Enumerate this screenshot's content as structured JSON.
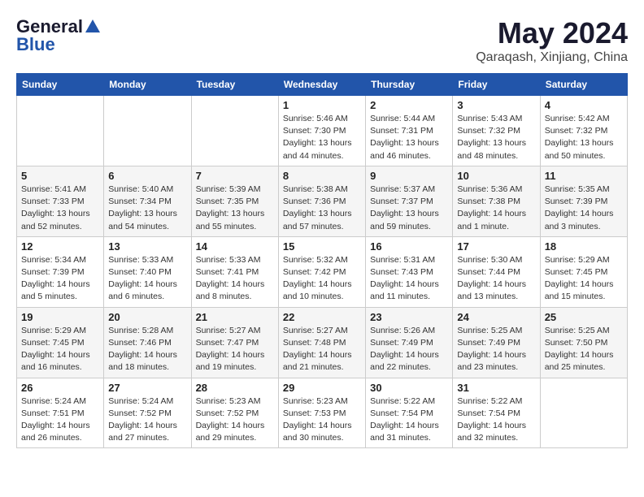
{
  "logo": {
    "general": "General",
    "blue": "Blue"
  },
  "title": "May 2024",
  "location": "Qaraqash, Xinjiang, China",
  "headers": [
    "Sunday",
    "Monday",
    "Tuesday",
    "Wednesday",
    "Thursday",
    "Friday",
    "Saturday"
  ],
  "weeks": [
    [
      {
        "day": "",
        "info": ""
      },
      {
        "day": "",
        "info": ""
      },
      {
        "day": "",
        "info": ""
      },
      {
        "day": "1",
        "info": "Sunrise: 5:46 AM\nSunset: 7:30 PM\nDaylight: 13 hours\nand 44 minutes."
      },
      {
        "day": "2",
        "info": "Sunrise: 5:44 AM\nSunset: 7:31 PM\nDaylight: 13 hours\nand 46 minutes."
      },
      {
        "day": "3",
        "info": "Sunrise: 5:43 AM\nSunset: 7:32 PM\nDaylight: 13 hours\nand 48 minutes."
      },
      {
        "day": "4",
        "info": "Sunrise: 5:42 AM\nSunset: 7:32 PM\nDaylight: 13 hours\nand 50 minutes."
      }
    ],
    [
      {
        "day": "5",
        "info": "Sunrise: 5:41 AM\nSunset: 7:33 PM\nDaylight: 13 hours\nand 52 minutes."
      },
      {
        "day": "6",
        "info": "Sunrise: 5:40 AM\nSunset: 7:34 PM\nDaylight: 13 hours\nand 54 minutes."
      },
      {
        "day": "7",
        "info": "Sunrise: 5:39 AM\nSunset: 7:35 PM\nDaylight: 13 hours\nand 55 minutes."
      },
      {
        "day": "8",
        "info": "Sunrise: 5:38 AM\nSunset: 7:36 PM\nDaylight: 13 hours\nand 57 minutes."
      },
      {
        "day": "9",
        "info": "Sunrise: 5:37 AM\nSunset: 7:37 PM\nDaylight: 13 hours\nand 59 minutes."
      },
      {
        "day": "10",
        "info": "Sunrise: 5:36 AM\nSunset: 7:38 PM\nDaylight: 14 hours\nand 1 minute."
      },
      {
        "day": "11",
        "info": "Sunrise: 5:35 AM\nSunset: 7:39 PM\nDaylight: 14 hours\nand 3 minutes."
      }
    ],
    [
      {
        "day": "12",
        "info": "Sunrise: 5:34 AM\nSunset: 7:39 PM\nDaylight: 14 hours\nand 5 minutes."
      },
      {
        "day": "13",
        "info": "Sunrise: 5:33 AM\nSunset: 7:40 PM\nDaylight: 14 hours\nand 6 minutes."
      },
      {
        "day": "14",
        "info": "Sunrise: 5:33 AM\nSunset: 7:41 PM\nDaylight: 14 hours\nand 8 minutes."
      },
      {
        "day": "15",
        "info": "Sunrise: 5:32 AM\nSunset: 7:42 PM\nDaylight: 14 hours\nand 10 minutes."
      },
      {
        "day": "16",
        "info": "Sunrise: 5:31 AM\nSunset: 7:43 PM\nDaylight: 14 hours\nand 11 minutes."
      },
      {
        "day": "17",
        "info": "Sunrise: 5:30 AM\nSunset: 7:44 PM\nDaylight: 14 hours\nand 13 minutes."
      },
      {
        "day": "18",
        "info": "Sunrise: 5:29 AM\nSunset: 7:45 PM\nDaylight: 14 hours\nand 15 minutes."
      }
    ],
    [
      {
        "day": "19",
        "info": "Sunrise: 5:29 AM\nSunset: 7:45 PM\nDaylight: 14 hours\nand 16 minutes."
      },
      {
        "day": "20",
        "info": "Sunrise: 5:28 AM\nSunset: 7:46 PM\nDaylight: 14 hours\nand 18 minutes."
      },
      {
        "day": "21",
        "info": "Sunrise: 5:27 AM\nSunset: 7:47 PM\nDaylight: 14 hours\nand 19 minutes."
      },
      {
        "day": "22",
        "info": "Sunrise: 5:27 AM\nSunset: 7:48 PM\nDaylight: 14 hours\nand 21 minutes."
      },
      {
        "day": "23",
        "info": "Sunrise: 5:26 AM\nSunset: 7:49 PM\nDaylight: 14 hours\nand 22 minutes."
      },
      {
        "day": "24",
        "info": "Sunrise: 5:25 AM\nSunset: 7:49 PM\nDaylight: 14 hours\nand 23 minutes."
      },
      {
        "day": "25",
        "info": "Sunrise: 5:25 AM\nSunset: 7:50 PM\nDaylight: 14 hours\nand 25 minutes."
      }
    ],
    [
      {
        "day": "26",
        "info": "Sunrise: 5:24 AM\nSunset: 7:51 PM\nDaylight: 14 hours\nand 26 minutes."
      },
      {
        "day": "27",
        "info": "Sunrise: 5:24 AM\nSunset: 7:52 PM\nDaylight: 14 hours\nand 27 minutes."
      },
      {
        "day": "28",
        "info": "Sunrise: 5:23 AM\nSunset: 7:52 PM\nDaylight: 14 hours\nand 29 minutes."
      },
      {
        "day": "29",
        "info": "Sunrise: 5:23 AM\nSunset: 7:53 PM\nDaylight: 14 hours\nand 30 minutes."
      },
      {
        "day": "30",
        "info": "Sunrise: 5:22 AM\nSunset: 7:54 PM\nDaylight: 14 hours\nand 31 minutes."
      },
      {
        "day": "31",
        "info": "Sunrise: 5:22 AM\nSunset: 7:54 PM\nDaylight: 14 hours\nand 32 minutes."
      },
      {
        "day": "",
        "info": ""
      }
    ]
  ]
}
